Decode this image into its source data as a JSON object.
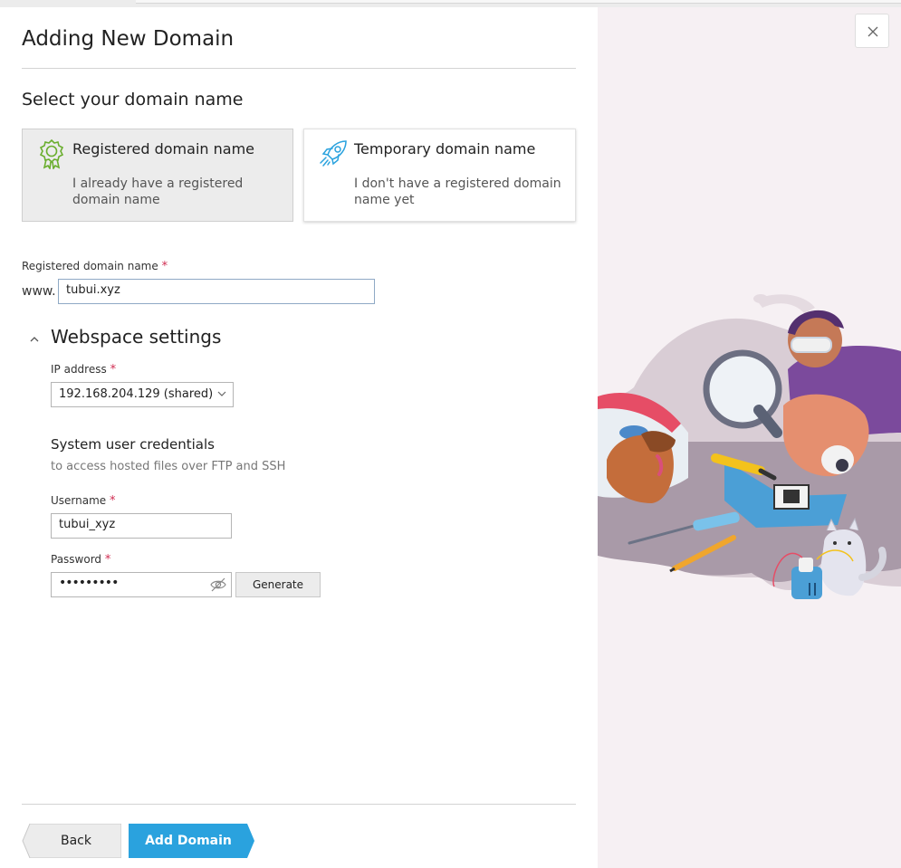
{
  "dialog": {
    "title": "Adding New Domain",
    "section_title": "Select your domain name",
    "close_icon": "close-icon"
  },
  "options": [
    {
      "title": "Registered domain name",
      "description": "I already have a registered domain name",
      "icon": "award-badge-icon",
      "selected": true
    },
    {
      "title": "Temporary domain name",
      "description": "I don't have a registered domain name yet",
      "icon": "rocket-icon",
      "selected": false
    }
  ],
  "domain_field": {
    "label": "Registered domain name",
    "required_mark": "*",
    "prefix": "www.",
    "value": "tubui.xyz"
  },
  "webspace": {
    "title": "Webspace settings",
    "expanded": true,
    "ip": {
      "label": "IP address",
      "required_mark": "*",
      "value": "192.168.204.129 (shared)"
    },
    "credentials": {
      "title": "System user credentials",
      "subtitle": "to access hosted files over FTP and SSH",
      "username_label": "Username",
      "username_value": "tubui_xyz",
      "password_label": "Password",
      "password_value": "•••••••••",
      "required_mark": "*",
      "generate_label": "Generate"
    }
  },
  "footer": {
    "back_label": "Back",
    "add_label": "Add Domain"
  },
  "colors": {
    "accent": "#2aa2de",
    "required": "#d02c51",
    "badge_green": "#6aae2e",
    "illustration_bg": "#f6f0f3"
  }
}
